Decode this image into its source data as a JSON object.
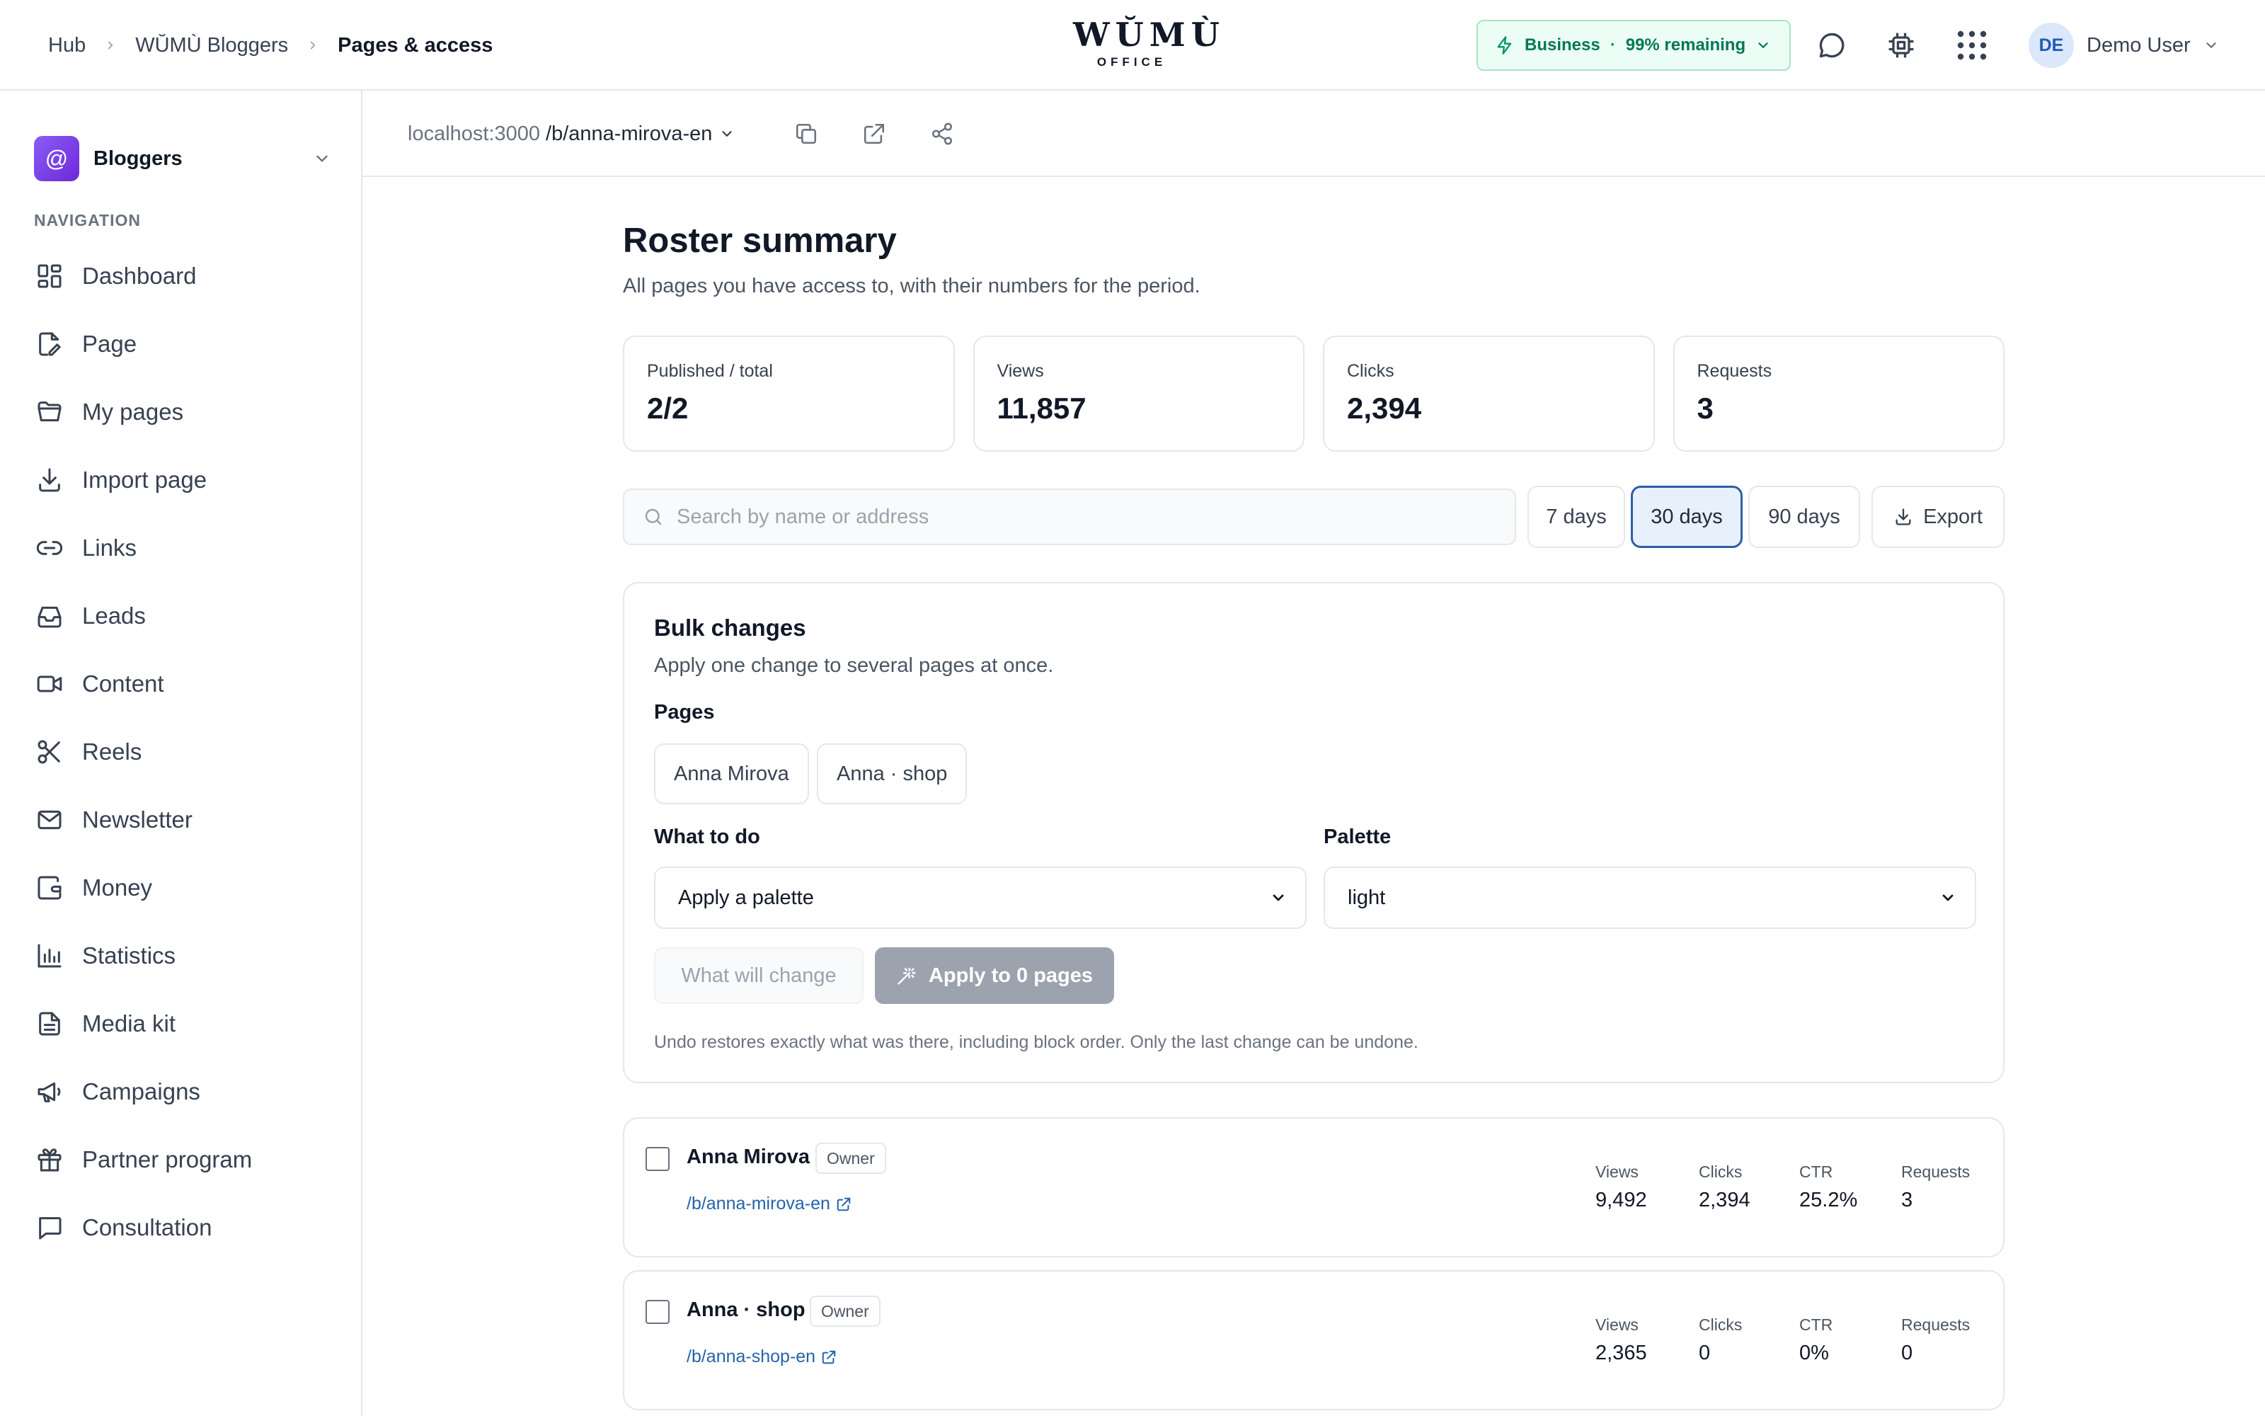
{
  "breadcrumb": {
    "items": [
      "Hub",
      "WŬMÙ Bloggers",
      "Pages & access"
    ]
  },
  "logo": {
    "word": "WŬMÙ",
    "sub": "OFFICE"
  },
  "plan": {
    "name": "Business",
    "separator": "·",
    "remaining": "99% remaining",
    "accent": "#047857"
  },
  "user": {
    "initials": "DE",
    "name": "Demo User"
  },
  "sidebar": {
    "workspace": "Bloggers",
    "workspace_icon": "at-sign",
    "nav_title": "NAVIGATION",
    "items": [
      {
        "label": "Dashboard",
        "icon": "dashboard-icon"
      },
      {
        "label": "Page",
        "icon": "page-edit-icon"
      },
      {
        "label": "My pages",
        "icon": "folder-icon"
      },
      {
        "label": "Import page",
        "icon": "download-icon"
      },
      {
        "label": "Links",
        "icon": "link-icon"
      },
      {
        "label": "Leads",
        "icon": "inbox-icon"
      },
      {
        "label": "Content",
        "icon": "video-icon"
      },
      {
        "label": "Reels",
        "icon": "scissors-icon"
      },
      {
        "label": "Newsletter",
        "icon": "mail-icon"
      },
      {
        "label": "Money",
        "icon": "wallet-icon"
      },
      {
        "label": "Statistics",
        "icon": "bar-chart-icon"
      },
      {
        "label": "Media kit",
        "icon": "document-icon"
      },
      {
        "label": "Campaigns",
        "icon": "megaphone-icon"
      },
      {
        "label": "Partner program",
        "icon": "gift-icon"
      },
      {
        "label": "Consultation",
        "icon": "chat-icon"
      }
    ]
  },
  "address": {
    "host": "localhost:3000",
    "path": "/b/anna-mirova-en"
  },
  "main": {
    "title": "Roster summary",
    "subtitle": "All pages you have access to, with their numbers for the period.",
    "stats": [
      {
        "label": "Published / total",
        "value": "2/2"
      },
      {
        "label": "Views",
        "value": "11,857"
      },
      {
        "label": "Clicks",
        "value": "2,394"
      },
      {
        "label": "Requests",
        "value": "3"
      }
    ],
    "search_placeholder": "Search by name or address",
    "periods": [
      "7 days",
      "30 days",
      "90 days"
    ],
    "active_period": "30 days",
    "export_label": "Export"
  },
  "bulk": {
    "title": "Bulk changes",
    "description": "Apply one change to several pages at once.",
    "pages_label": "Pages",
    "pages": [
      "Anna Mirova",
      "Anna · shop"
    ],
    "action_label": "What to do",
    "action_value": "Apply a palette",
    "palette_label": "Palette",
    "palette_value": "light",
    "preview_label": "What will change",
    "apply_label": "Apply to 0 pages",
    "note": "Undo restores exactly what was there, including block order. Only the last change can be undone."
  },
  "rows": [
    {
      "name": "Anna Mirova",
      "role": "Owner",
      "link": "/b/anna-mirova-en",
      "metrics": [
        {
          "label": "Views",
          "value": "9,492"
        },
        {
          "label": "Clicks",
          "value": "2,394"
        },
        {
          "label": "CTR",
          "value": "25.2%"
        },
        {
          "label": "Requests",
          "value": "3"
        }
      ]
    },
    {
      "name": "Anna · shop",
      "role": "Owner",
      "link": "/b/anna-shop-en",
      "metrics": [
        {
          "label": "Views",
          "value": "2,365"
        },
        {
          "label": "Clicks",
          "value": "0"
        },
        {
          "label": "CTR",
          "value": "0%"
        },
        {
          "label": "Requests",
          "value": "0"
        }
      ]
    }
  ]
}
